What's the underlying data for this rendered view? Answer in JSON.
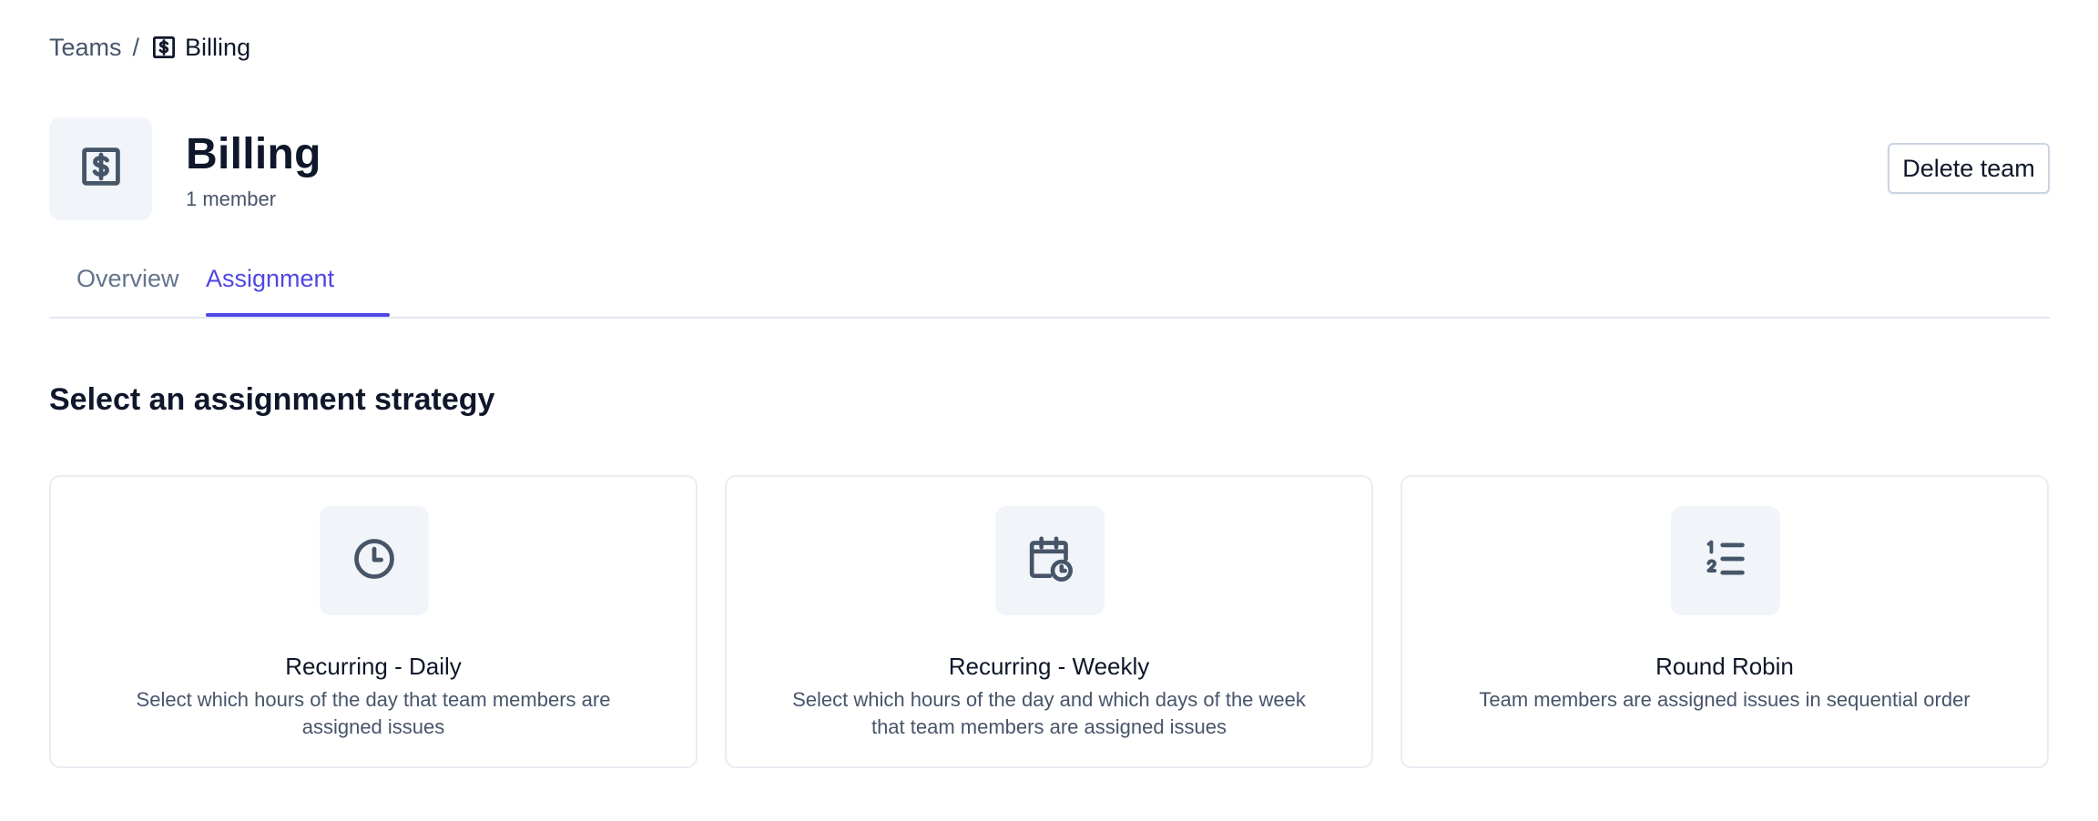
{
  "breadcrumb": {
    "parent": "Teams",
    "separator": "/",
    "current": "Billing",
    "current_icon": "dollar-sign-square-icon"
  },
  "team": {
    "name": "Billing",
    "member_count": "1 member",
    "avatar_icon": "dollar-sign-square-icon"
  },
  "actions": {
    "delete_label": "Delete team"
  },
  "tabs": [
    {
      "label": "Overview",
      "active": false
    },
    {
      "label": "Assignment",
      "active": true
    }
  ],
  "section": {
    "heading": "Select an assignment strategy"
  },
  "strategies": [
    {
      "icon": "clock-icon",
      "title": "Recurring - Daily",
      "description": "Select which hours of the day that team members are assigned issues"
    },
    {
      "icon": "calendar-clock-icon",
      "title": "Recurring - Weekly",
      "description": "Select which hours of the day and which days of the week that team members are assigned issues"
    },
    {
      "icon": "numbered-list-icon",
      "title": "Round Robin",
      "description": "Team members are assigned issues in sequential order"
    }
  ],
  "colors": {
    "accent": "#4f46e5",
    "text_primary": "#0f172a",
    "text_muted": "#475569",
    "icon_bg": "#f1f5f9",
    "border": "#e2e8f0"
  }
}
